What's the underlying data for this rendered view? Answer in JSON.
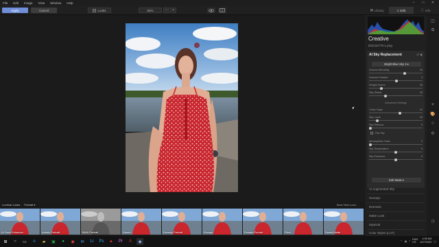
{
  "menu": [
    "File",
    "Edit",
    "Image",
    "View",
    "Window",
    "Help"
  ],
  "toolbar": {
    "apply": "Apply",
    "cancel": "Cancel",
    "looks": "Looks",
    "zoom": "54%",
    "zoom_minus": "−",
    "zoom_plus": "+"
  },
  "panel_tabs": [
    {
      "label": "Library"
    },
    {
      "label": "Edit"
    },
    {
      "label": "Info"
    }
  ],
  "panel": {
    "title": "Creative",
    "filename": "DSC02770-1.png",
    "section": {
      "title": "AI Sky Replacement",
      "dropdown": "Bright Blue Sky 3",
      "sliders": [
        {
          "label": "Horizon Blending",
          "value": "40",
          "pos": 0.68
        },
        {
          "label": "Horizon Position",
          "value": "2",
          "pos": 0.52
        },
        {
          "label": "Relight Scene",
          "value": "25",
          "pos": 0.22
        },
        {
          "label": "Sky Global",
          "value": "30",
          "pos": 0.3
        }
      ],
      "advanced": "Advanced Settings",
      "adv_sliders": [
        {
          "label": "Close Gaps",
          "value": "10",
          "pos": 0.58
        },
        {
          "label": "Sky Local",
          "value": "25",
          "pos": 0.14
        },
        {
          "label": "Sky Defocus",
          "value": "0",
          "pos": 0.0
        }
      ],
      "flip_sky": "Flip Sky",
      "adv_sliders_2": [
        {
          "label": "Atmospheric Haze",
          "value": "0",
          "pos": 0.0
        },
        {
          "label": "Sky Temperature",
          "value": "0",
          "pos": 0.5
        },
        {
          "label": "Sky Exposure",
          "value": "0",
          "pos": 0.5
        }
      ],
      "edit_mask": "Edit Mask"
    },
    "tools": [
      "AI Augmented Sky",
      "Sunrays",
      "Dramatic",
      "Matte Look",
      "Mystical",
      "Color Styles (LUT)"
    ]
  },
  "looks": {
    "title": "Luminar Looks",
    "category": "Portrait",
    "save": "Save New Look...",
    "items": [
      {
        "label": "AI Face Enhancer",
        "bw": false
      },
      {
        "label": "Artistic Portrait",
        "bw": false
      },
      {
        "label": "B&W Portrait",
        "bw": true
      },
      {
        "label": "Desert",
        "bw": false
      },
      {
        "label": "Dreamy Portrait",
        "bw": false
      },
      {
        "label": "Escape",
        "bw": false
      },
      {
        "label": "Female Portrait",
        "bw": false
      },
      {
        "label": "Fleet",
        "bw": false
      },
      {
        "label": "Sweet Matte",
        "bw": false
      }
    ]
  },
  "taskbar": {
    "lang": "ENG\nUS",
    "time": "4:39 AM",
    "date": "6/27/2020"
  }
}
